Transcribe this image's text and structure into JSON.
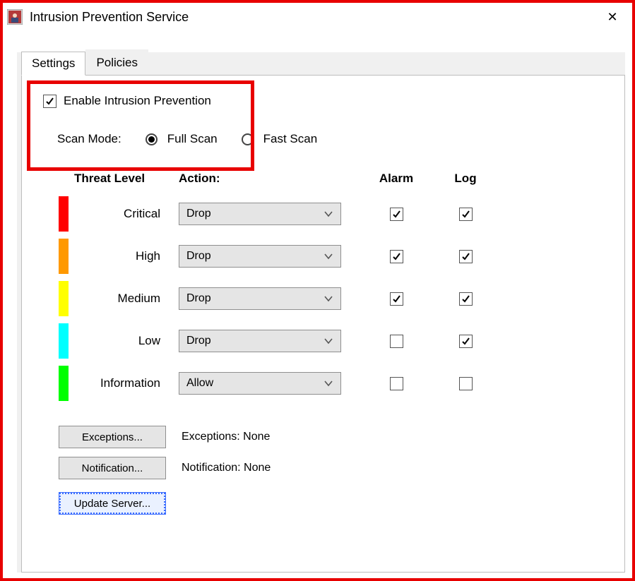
{
  "window": {
    "title": "Intrusion Prevention Service",
    "close_glyph": "✕"
  },
  "tabs": {
    "settings": "Settings",
    "policies": "Policies",
    "active": "settings"
  },
  "enable": {
    "label": "Enable Intrusion Prevention",
    "checked": true
  },
  "scanmode": {
    "label": "Scan Mode:",
    "options": {
      "full": "Full Scan",
      "fast": "Fast Scan"
    },
    "selected": "full"
  },
  "headers": {
    "threat": "Threat Level",
    "action": "Action:",
    "alarm": "Alarm",
    "log": "Log"
  },
  "levels": [
    {
      "name": "Critical",
      "color": "#ff0000",
      "action": "Drop",
      "alarm": true,
      "log": true
    },
    {
      "name": "High",
      "color": "#ff9900",
      "action": "Drop",
      "alarm": true,
      "log": true
    },
    {
      "name": "Medium",
      "color": "#ffff00",
      "action": "Drop",
      "alarm": true,
      "log": true
    },
    {
      "name": "Low",
      "color": "#00ffff",
      "action": "Drop",
      "alarm": false,
      "log": true
    },
    {
      "name": "Information",
      "color": "#00ff00",
      "action": "Allow",
      "alarm": false,
      "log": false
    }
  ],
  "buttons": {
    "exceptions": "Exceptions...",
    "notification": "Notification...",
    "update_server": "Update Server..."
  },
  "status": {
    "exceptions": "Exceptions: None",
    "notification": "Notification: None"
  }
}
